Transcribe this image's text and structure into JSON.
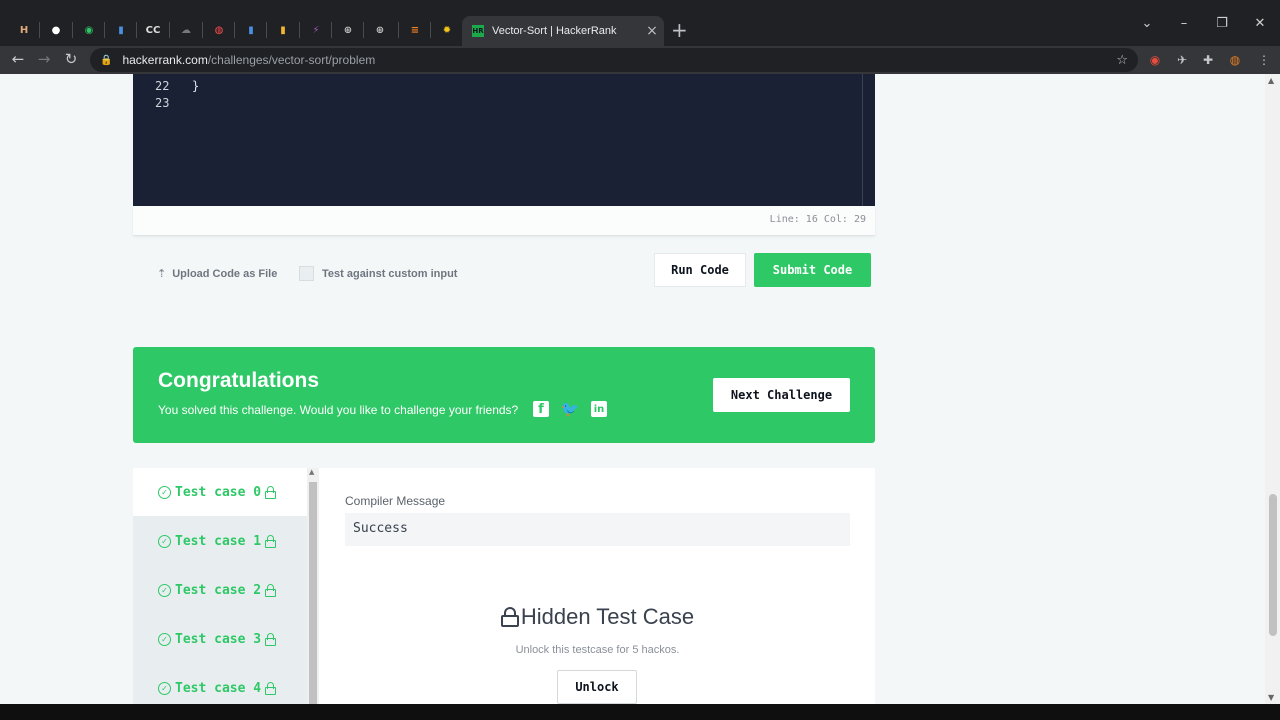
{
  "browser": {
    "active_tab_title": "Vector-Sort | HackerRank",
    "active_tab_favicon": "HR",
    "url_host": "hackerrank.com",
    "url_path": "/challenges/vector-sort/problem",
    "pinned_tabs": [
      {
        "icon": "hackerrank-h-icon",
        "glyph": "H",
        "color": "#e0a97a"
      },
      {
        "icon": "github-icon",
        "glyph": "●",
        "color": "#ffffff"
      },
      {
        "icon": "green-circle-icon",
        "glyph": "◉",
        "color": "#2ec866"
      },
      {
        "icon": "bar-chart-icon",
        "glyph": "▮",
        "color": "#4a90e2"
      },
      {
        "icon": "cc-icon",
        "glyph": "CC",
        "color": "#dddddd"
      },
      {
        "icon": "cloud-icon",
        "glyph": "☁",
        "color": "#777777"
      },
      {
        "icon": "red-circle-icon",
        "glyph": "◍",
        "color": "#ff4d4d"
      },
      {
        "icon": "chart-icon",
        "glyph": "▮",
        "color": "#4a90e2"
      },
      {
        "icon": "colorful-icon",
        "glyph": "▮",
        "color": "#f2b632"
      },
      {
        "icon": "lightning-icon",
        "glyph": "⚡",
        "color": "#9b59b6"
      },
      {
        "icon": "globe-icon",
        "glyph": "⊕",
        "color": "#c0c0c0"
      },
      {
        "icon": "globe-icon-2",
        "glyph": "⊕",
        "color": "#c0c0c0"
      },
      {
        "icon": "stack-icon",
        "glyph": "≡",
        "color": "#f48024"
      },
      {
        "icon": "sun-icon",
        "glyph": "✹",
        "color": "#f5c518"
      }
    ]
  },
  "editor": {
    "lines": [
      {
        "num": "22",
        "code": "}"
      },
      {
        "num": "23",
        "code": ""
      }
    ],
    "status": "Line: 16 Col: 29"
  },
  "actions": {
    "upload_label": "Upload Code as File",
    "custom_input_label": "Test against custom input",
    "run_label": "Run Code",
    "submit_label": "Submit Code"
  },
  "congrats": {
    "title": "Congratulations",
    "message": "You solved this challenge. Would you like to challenge your friends?",
    "next_label": "Next Challenge"
  },
  "results": {
    "test_cases": [
      {
        "label": "Test case 0",
        "active": true
      },
      {
        "label": "Test case 1",
        "active": false
      },
      {
        "label": "Test case 2",
        "active": false
      },
      {
        "label": "Test case 3",
        "active": false
      },
      {
        "label": "Test case 4",
        "active": false
      }
    ],
    "compiler_label": "Compiler Message",
    "compiler_value": "Success",
    "hidden_title": "Hidden Test Case",
    "hidden_sub": "Unlock this testcase for 5 hackos.",
    "unlock_label": "Unlock"
  },
  "colors": {
    "accent_green": "#2ec866",
    "editor_bg": "#1b2134",
    "page_bg": "#f3f7f7"
  }
}
